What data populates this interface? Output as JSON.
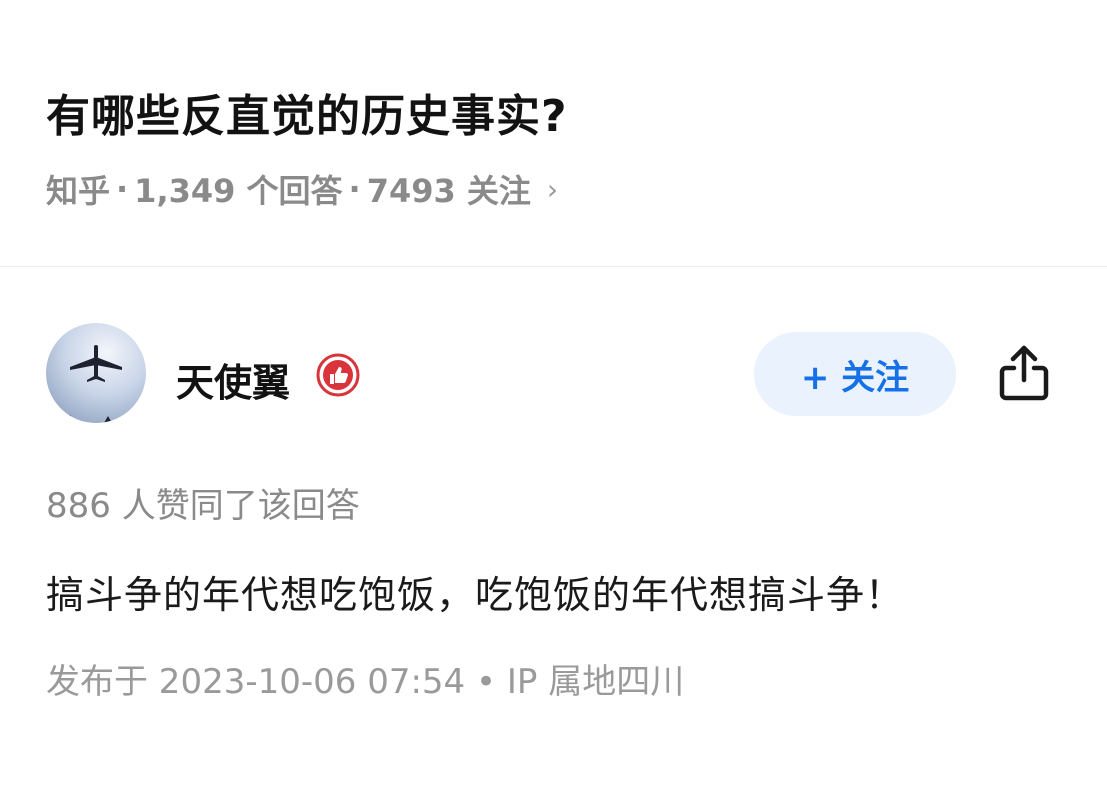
{
  "question": {
    "title": "有哪些反直觉的历史事实?",
    "source": "知乎",
    "separator": "·",
    "answer_count": "1,349 个回答",
    "follower_count": "7493 关注",
    "chevron": "›"
  },
  "author": {
    "name": "天使翼",
    "avatar_icon": "airplane-avatar",
    "badge_icon": "thumbs-up-badge-icon",
    "follow_label": "+ 关注",
    "share_icon": "share-icon"
  },
  "answer": {
    "upvotes": "886 人赞同了该回答",
    "content": "搞斗争的年代想吃饱饭，吃饱饭的年代想搞斗争！",
    "published": "发布于 2023-10-06 07:54 • IP 属地四川"
  },
  "colors": {
    "accent": "#1670e8",
    "follow_bg": "#eaf2fd",
    "badge": "#d9343a",
    "meta_gray": "#8a8a8a"
  }
}
